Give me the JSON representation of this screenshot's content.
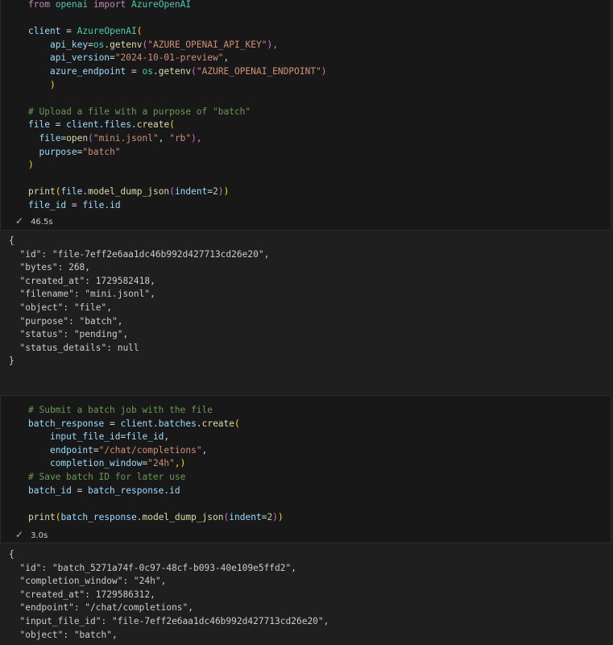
{
  "cell1": {
    "lines": {
      "l1": {
        "a": "from",
        "b": "openai",
        "c": "import",
        "d": "AzureOpenAI"
      },
      "l3": {
        "a": "client",
        "b": "=",
        "c": "AzureOpenAI",
        "d": "("
      },
      "l4": {
        "a": "api_key",
        "b": "=",
        "c": "os",
        "d": ".",
        "e": "getenv",
        "f": "(",
        "g": "\"AZURE_OPENAI_API_KEY\"",
        "h": "),"
      },
      "l5": {
        "a": "api_version",
        "b": "=",
        "c": "\"2024-10-01-preview\"",
        "d": ","
      },
      "l6": {
        "a": "azure_endpoint",
        "b": " = ",
        "c": "os",
        "d": ".",
        "e": "getenv",
        "f": "(",
        "g": "\"AZURE_OPENAI_ENDPOINT\"",
        "h": ")"
      },
      "l7": {
        "a": ")"
      },
      "l9": {
        "a": "# Upload a file with a purpose of \"batch\""
      },
      "l10": {
        "a": "file",
        "b": " = ",
        "c": "client",
        "d": ".",
        "e": "files",
        "f": ".",
        "g": "create",
        "h": "("
      },
      "l11": {
        "a": "file",
        "b": "=",
        "c": "open",
        "d": "(",
        "e": "\"mini.jsonl\"",
        "f": ", ",
        "g": "\"rb\"",
        "h": "),"
      },
      "l12": {
        "a": "purpose",
        "b": "=",
        "c": "\"batch\""
      },
      "l13": {
        "a": ")"
      },
      "l15": {
        "a": "print",
        "b": "(",
        "c": "file",
        "d": ".",
        "e": "model_dump_json",
        "f": "(",
        "g": "indent",
        "h": "=",
        "i": "2",
        "j": ")",
        "k": ")"
      },
      "l16": {
        "a": "file_id",
        "b": " = ",
        "c": "file",
        "d": ".",
        "e": "id"
      }
    },
    "status": {
      "time": "46.5s"
    },
    "output": [
      "{",
      "  \"id\": \"file-7eff2e6aa1dc46b992d427713cd26e20\",",
      "  \"bytes\": 268,",
      "  \"created_at\": 1729582418,",
      "  \"filename\": \"mini.jsonl\",",
      "  \"object\": \"file\",",
      "  \"purpose\": \"batch\",",
      "  \"status\": \"pending\",",
      "  \"status_details\": null",
      "}"
    ]
  },
  "cell2": {
    "lines": {
      "l1": {
        "a": "# Submit a batch job with the file"
      },
      "l2": {
        "a": "batch_response",
        "b": " = ",
        "c": "client",
        "d": ".",
        "e": "batches",
        "f": ".",
        "g": "create",
        "h": "("
      },
      "l3": {
        "a": "input_file_id",
        "b": "=",
        "c": "file_id",
        "d": ","
      },
      "l4": {
        "a": "endpoint",
        "b": "=",
        "c": "\"/chat/completions\"",
        "d": ","
      },
      "l5": {
        "a": "completion_window",
        "b": "=",
        "c": "\"24h\"",
        "d": ",)"
      },
      "l6": {
        "a": "# Save batch ID for later use"
      },
      "l7": {
        "a": "batch_id",
        "b": " = ",
        "c": "batch_response",
        "d": ".",
        "e": "id"
      },
      "l9": {
        "a": "print",
        "b": "(",
        "c": "batch_response",
        "d": ".",
        "e": "model_dump_json",
        "f": "(",
        "g": "indent",
        "h": "=",
        "i": "2",
        "j": ")",
        "k": ")"
      }
    },
    "status": {
      "time": "3.0s"
    },
    "output": [
      "{",
      "  \"id\": \"batch_5271a74f-0c97-48cf-b093-40e109e5ffd2\",",
      "  \"completion_window\": \"24h\",",
      "  \"created_at\": 1729586312,",
      "  \"endpoint\": \"/chat/completions\",",
      "  \"input_file_id\": \"file-7eff2e6aa1dc46b992d427713cd26e20\",",
      "  \"object\": \"batch\","
    ]
  }
}
